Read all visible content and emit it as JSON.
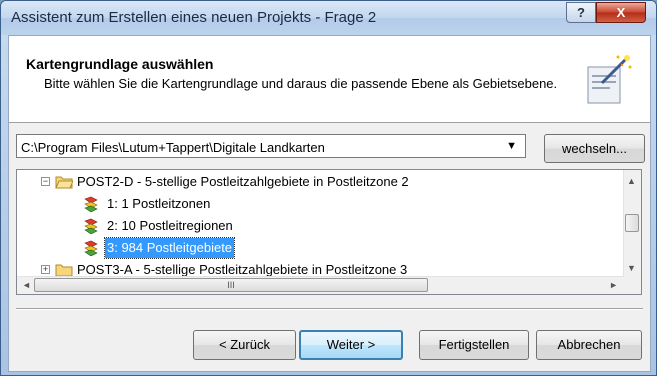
{
  "window": {
    "title": "Assistent zum Erstellen eines neuen Projekts  -  Frage 2",
    "help_label": "?",
    "close_label": "X"
  },
  "header": {
    "title": "Kartengrundlage auswählen",
    "description": "Bitte wählen Sie die Kartengrundlage und daraus die passende Ebene als Gebietsebene.",
    "icon": "wizard-icon"
  },
  "path": {
    "value": "C:\\Program Files\\Lutum+Tappert\\Digitale Landkarten",
    "arrow": "▼",
    "change_button": "wechseln..."
  },
  "tree": {
    "items": [
      {
        "label": "POST2-D - 5-stellige Postleitzahlgebiete in Postleitzone 2",
        "type": "folder",
        "expanded": true,
        "expander": "−"
      },
      {
        "label": "1: 1 Postleitzonen",
        "type": "layer"
      },
      {
        "label": "2: 10 Postleitregionen",
        "type": "layer"
      },
      {
        "label": "3: 984 Postleitgebiete",
        "type": "layer",
        "selected": true
      },
      {
        "label": "POST3-A - 5-stellige Postleitzahlgebiete in Postleitzone 3",
        "type": "folder",
        "expanded": false,
        "expander": "+"
      }
    ],
    "scroll_up": "▲",
    "scroll_down": "▼",
    "scroll_left": "◄",
    "scroll_right": "►",
    "hthumb_grip": "III"
  },
  "buttons": {
    "back": "< Zurück",
    "next": "Weiter >",
    "finish": "Fertigstellen",
    "cancel": "Abbrechen"
  },
  "colors": {
    "selection": "#3399ff",
    "default_button_border": "#3c7fb1"
  }
}
